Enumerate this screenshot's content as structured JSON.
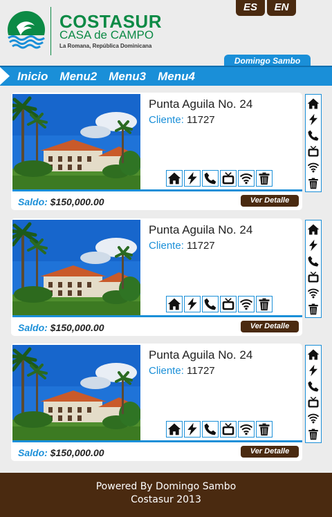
{
  "brand": {
    "name": "COSTASUR",
    "subtitle": "CASA de CAMPO",
    "location": "La Romana, República Dominicana",
    "green": "#0c8a45"
  },
  "languages": [
    "ES",
    "EN"
  ],
  "user": {
    "name": "Domingo Sambo"
  },
  "menu": {
    "items": [
      "Inicio",
      "Menu2",
      "Menu3",
      "Menu4"
    ]
  },
  "colors": {
    "accent": "#1a8fd8",
    "brown": "#4a2a10",
    "background": "#ececec"
  },
  "service_icons": [
    "home-icon",
    "electricity-icon",
    "phone-icon",
    "tv-icon",
    "wifi-icon",
    "trash-icon"
  ],
  "properties": [
    {
      "title": "Punta Aguila No. 24",
      "client_label": "Cliente:",
      "client_id": "11727",
      "balance_label": "Saldo:",
      "balance": "$150,000.00",
      "detail_label": "Ver Detalle"
    },
    {
      "title": "Punta Aguila No. 24",
      "client_label": "Cliente:",
      "client_id": "11727",
      "balance_label": "Saldo:",
      "balance": "$150,000.00",
      "detail_label": "Ver Detalle"
    },
    {
      "title": "Punta Aguila No. 24",
      "client_label": "Cliente:",
      "client_id": "11727",
      "balance_label": "Saldo:",
      "balance": "$150,000.00",
      "detail_label": "Ver Detalle"
    }
  ],
  "footer": {
    "line1": "Powered By Domingo Sambo",
    "line2": "Costasur 2013"
  }
}
